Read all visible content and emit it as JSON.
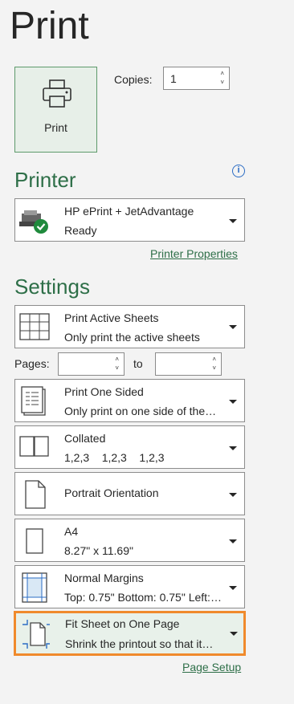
{
  "page": {
    "title": "Print"
  },
  "print_button": {
    "label": "Print",
    "icon": "printer-icon"
  },
  "copies": {
    "label": "Copies:",
    "value": "1"
  },
  "printer": {
    "section_title": "Printer",
    "name": "HP ePrint + JetAdvantage",
    "status": "Ready",
    "properties_link": "Printer Properties"
  },
  "settings": {
    "section_title": "Settings",
    "print_what": {
      "title": "Print Active Sheets",
      "subtitle": "Only print the active sheets"
    },
    "pages": {
      "label": "Pages:",
      "to_label": "to",
      "from_value": "",
      "to_value": ""
    },
    "sides": {
      "title": "Print One Sided",
      "subtitle": "Only print on one side of the…"
    },
    "collation": {
      "title": "Collated",
      "subtitle": "1,2,3    1,2,3    1,2,3"
    },
    "orientation": {
      "title": "Portrait Orientation"
    },
    "paper": {
      "title": "A4",
      "subtitle": "8.27\" x 11.69\""
    },
    "margins": {
      "title": "Normal Margins",
      "subtitle": "Top: 0.75\" Bottom: 0.75\" Left:…"
    },
    "scaling": {
      "title": "Fit Sheet on One Page",
      "subtitle": "Shrink the printout so that it…"
    },
    "page_setup_link": "Page Setup"
  },
  "colors": {
    "accent_green": "#2e6f48",
    "highlight_orange": "#f08a2c",
    "info_blue": "#2b6cc4"
  }
}
